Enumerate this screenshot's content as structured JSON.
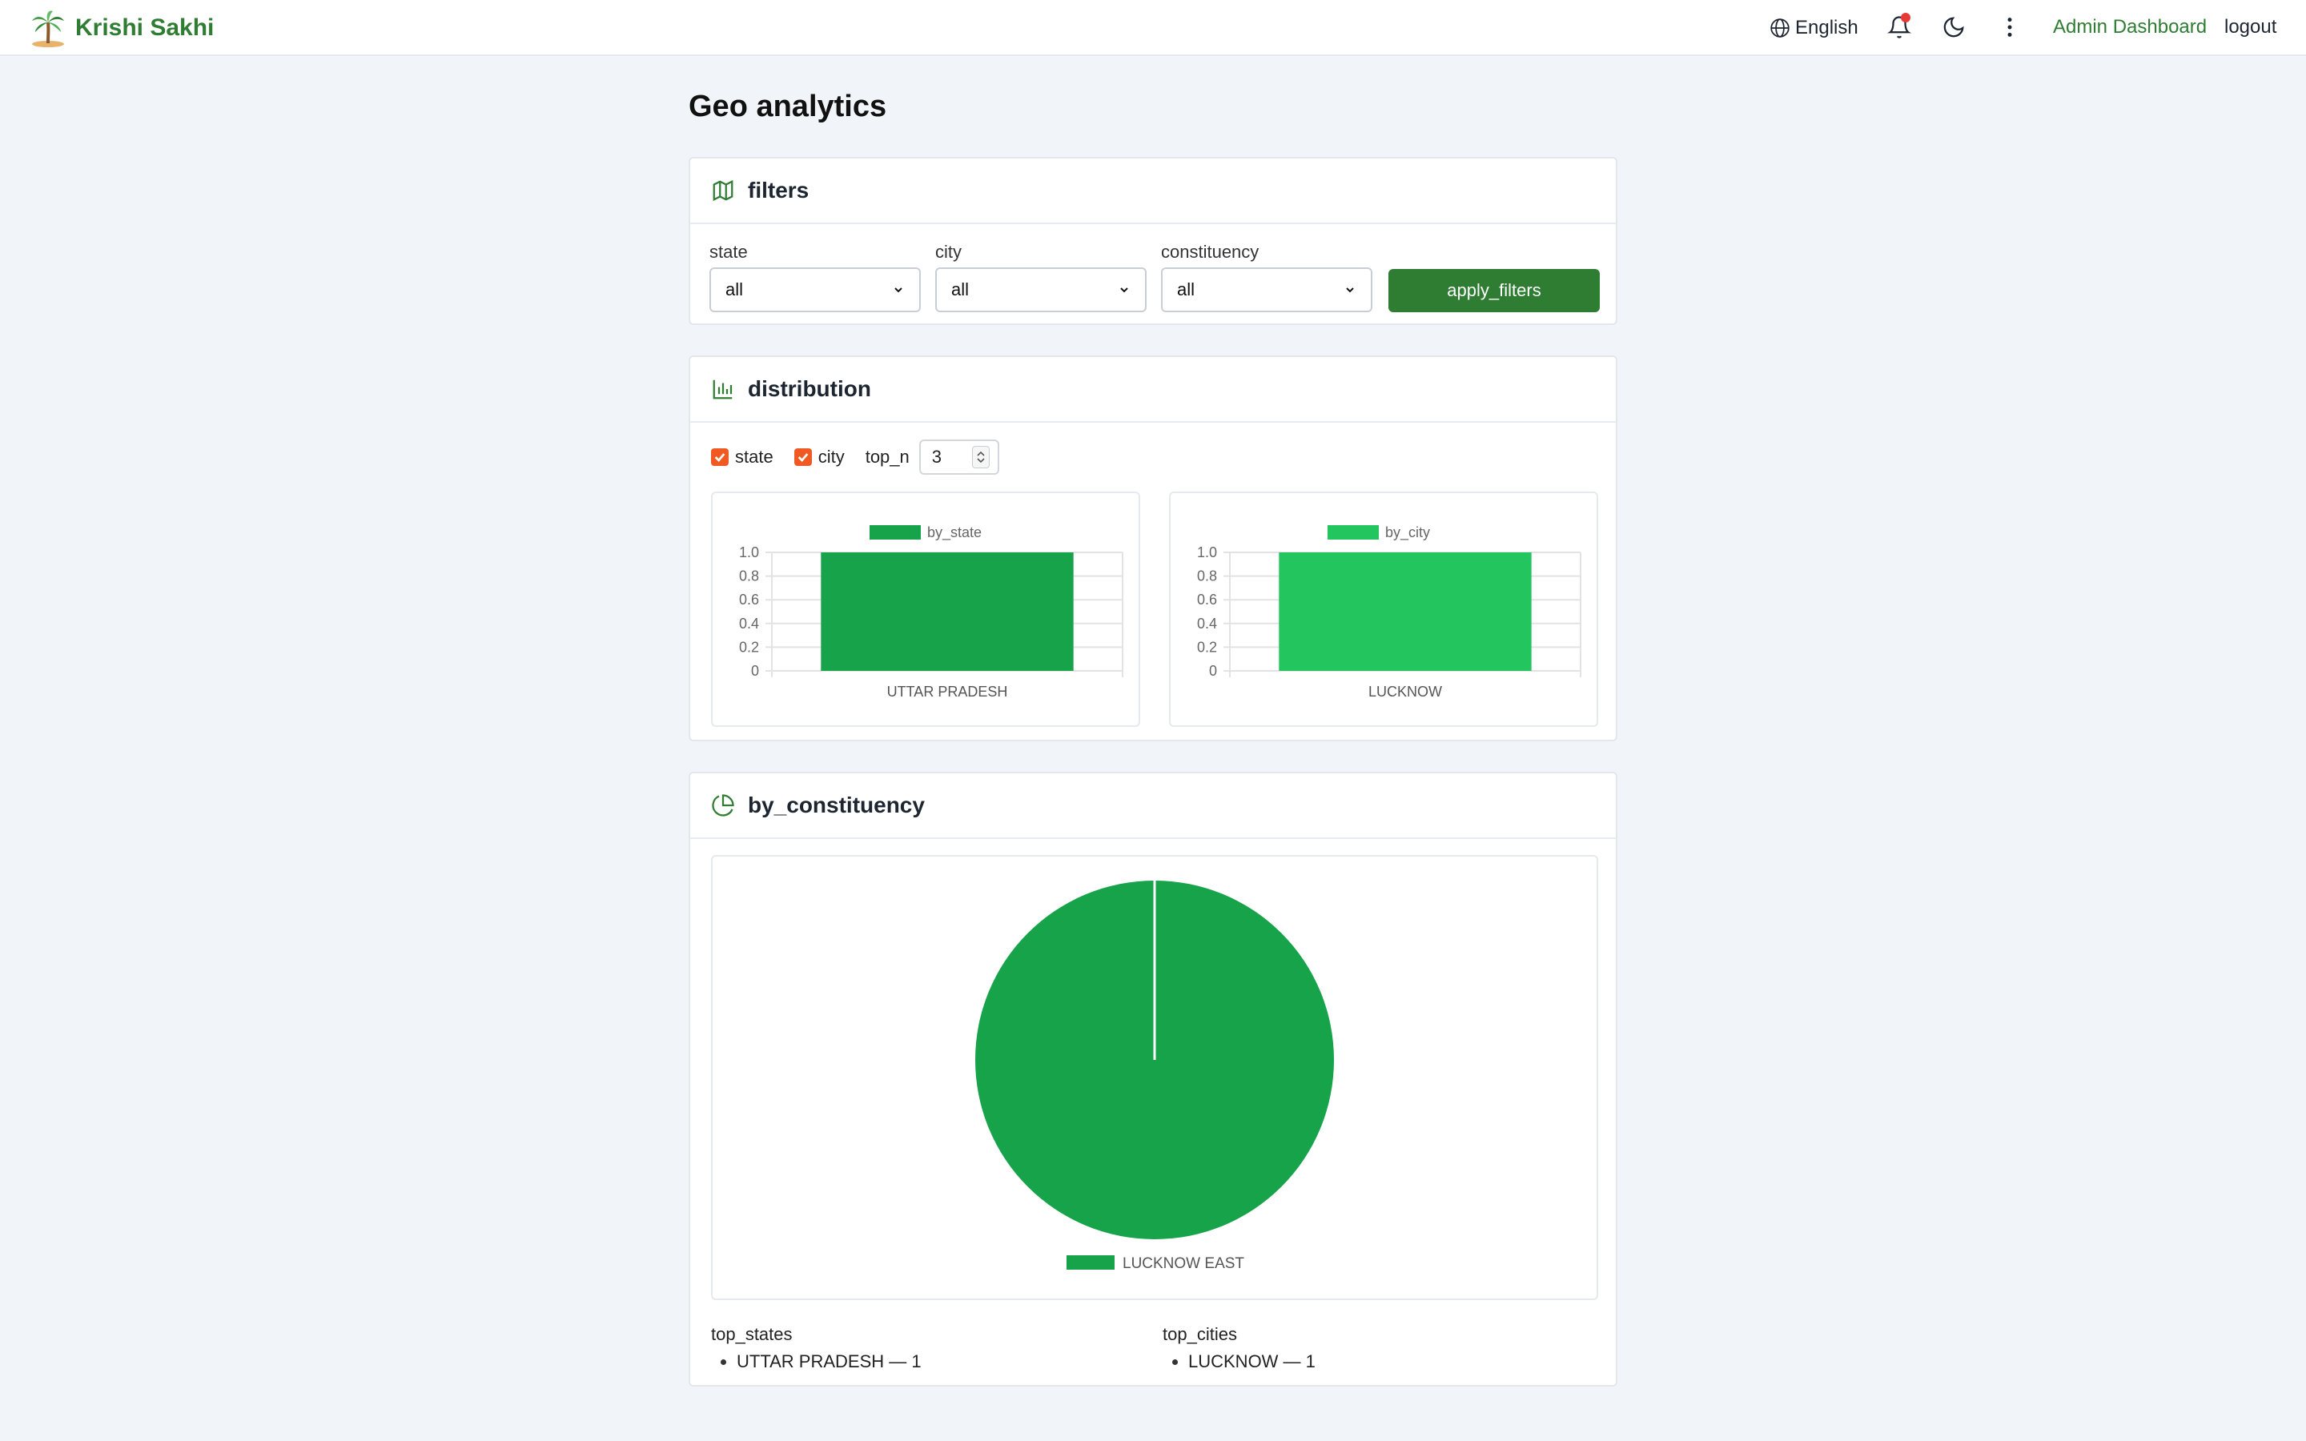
{
  "app": {
    "name": "Krishi Sakhi",
    "language": "English",
    "admin_link": "Admin Dashboard",
    "logout_label": "logout"
  },
  "page": {
    "title": "Geo analytics"
  },
  "filters": {
    "title": "filters",
    "state_label": "state",
    "state_value": "all",
    "city_label": "city",
    "city_value": "all",
    "constituency_label": "constituency",
    "constituency_value": "all",
    "apply_label": "apply_filters"
  },
  "distribution": {
    "title": "distribution",
    "state_checkbox_label": "state",
    "state_checked": true,
    "city_checkbox_label": "city",
    "city_checked": true,
    "top_n_label": "top_n",
    "top_n_value": "3"
  },
  "constituency": {
    "title": "by_constituency",
    "top_states_title": "top_states",
    "top_states": [
      "UTTAR PRADESH — 1"
    ],
    "top_cities_title": "top_cities",
    "top_cities": [
      "LUCKNOW — 1"
    ]
  },
  "colors": {
    "brand": "#2e7d32",
    "state_bar": "#16a34a",
    "city_bar": "#22c55e",
    "pie": "#16a34a",
    "checkbox": "#f05a22"
  },
  "chart_data": [
    {
      "type": "bar",
      "series": [
        {
          "name": "by_state",
          "values": [
            1
          ]
        }
      ],
      "categories": [
        "UTTAR PRADESH"
      ],
      "ylim": [
        0,
        1.0
      ],
      "yticks": [
        "0",
        "0.2",
        "0.4",
        "0.6",
        "0.8",
        "1.0"
      ],
      "legend": "top-center",
      "grid": true
    },
    {
      "type": "bar",
      "series": [
        {
          "name": "by_city",
          "values": [
            1
          ]
        }
      ],
      "categories": [
        "LUCKNOW"
      ],
      "ylim": [
        0,
        1.0
      ],
      "yticks": [
        "0",
        "0.2",
        "0.4",
        "0.6",
        "0.8",
        "1.0"
      ],
      "legend": "top-center",
      "grid": true
    },
    {
      "type": "pie",
      "categories": [
        "LUCKNOW EAST"
      ],
      "values": [
        1
      ],
      "legend": "bottom"
    }
  ]
}
